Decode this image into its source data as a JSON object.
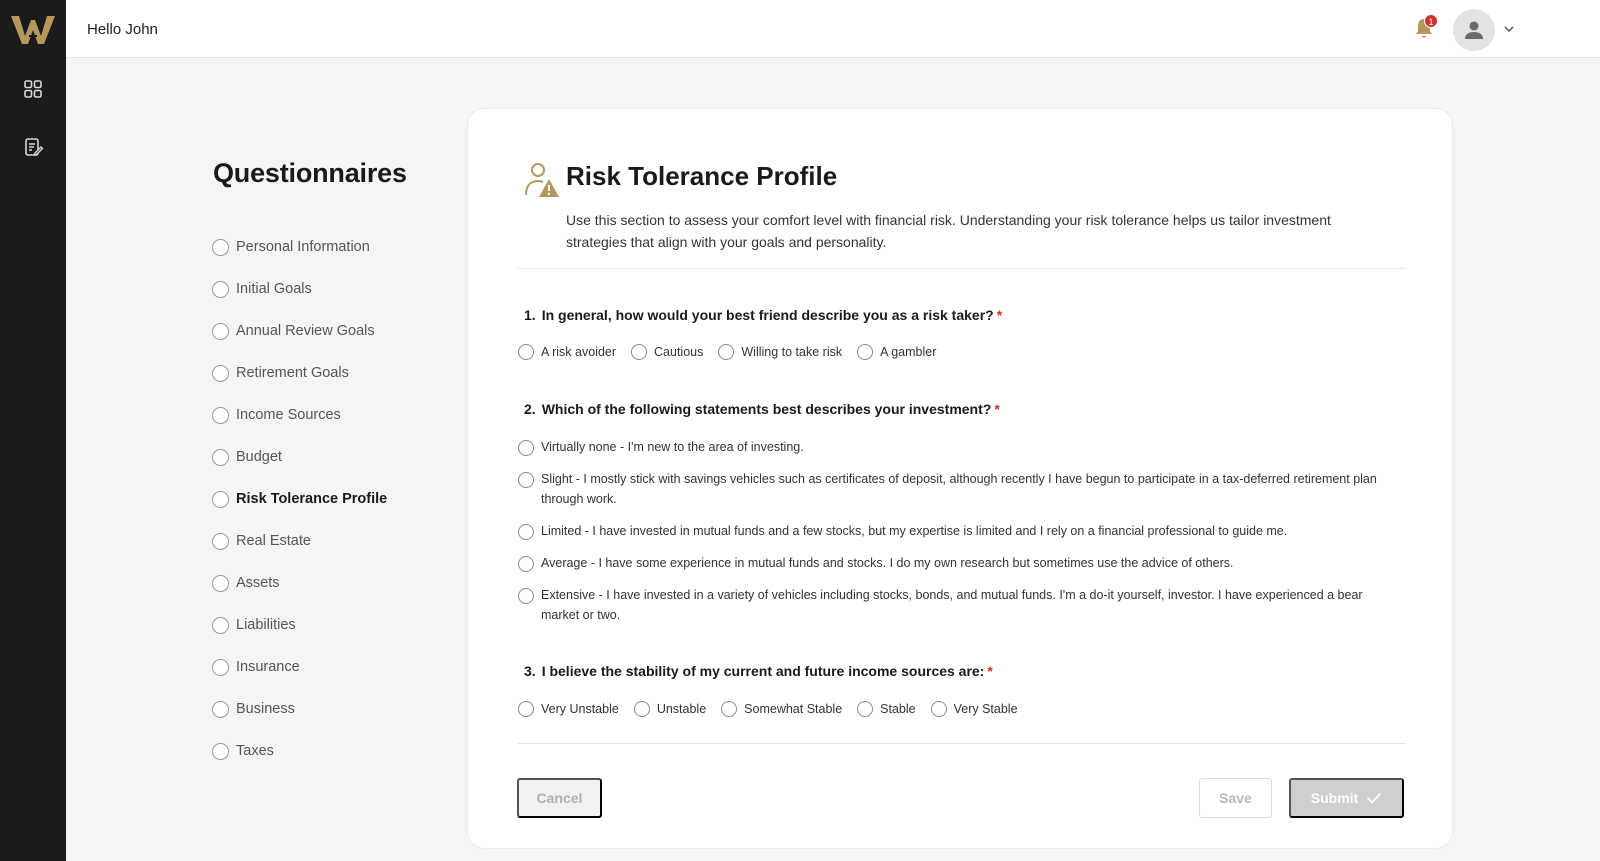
{
  "header": {
    "greeting": "Hello John",
    "notification_count": "1"
  },
  "questionnaires": {
    "title": "Questionnaires",
    "items": [
      {
        "label": "Personal Information",
        "active": false
      },
      {
        "label": "Initial Goals",
        "active": false
      },
      {
        "label": "Annual Review Goals",
        "active": false
      },
      {
        "label": "Retirement Goals",
        "active": false
      },
      {
        "label": "Income Sources",
        "active": false
      },
      {
        "label": "Budget",
        "active": false
      },
      {
        "label": "Risk Tolerance Profile",
        "active": true
      },
      {
        "label": "Real Estate",
        "active": false
      },
      {
        "label": "Assets",
        "active": false
      },
      {
        "label": "Liabilities",
        "active": false
      },
      {
        "label": "Insurance",
        "active": false
      },
      {
        "label": "Business",
        "active": false
      },
      {
        "label": "Taxes",
        "active": false
      }
    ]
  },
  "section": {
    "title": "Risk Tolerance Profile",
    "description": "Use this section to assess your comfort level with financial risk. Understanding your risk tolerance helps us tailor investment strategies that align with your goals and personality.",
    "questions": [
      {
        "number": "1.",
        "text": "In general, how would your best friend describe you as a risk taker?",
        "required": "*",
        "options": [
          "A risk avoider",
          "Cautious",
          "Willing to take risk",
          "A gambler"
        ]
      },
      {
        "number": "2.",
        "text": "Which of the following statements best describes your investment?",
        "required": "*",
        "options": [
          "Virtually none -  I'm new to the area of investing.",
          "Slight - I mostly stick with savings vehicles such as certificates of deposit, although recently I have begun to participate in a tax-deferred retirement plan through work.",
          "Limited - I have invested in mutual funds and a few stocks, but my expertise is limited and I rely on a financial professional to guide me.",
          "Average - I have some experience in mutual funds and stocks. I do my own research but sometimes use the advice of others.",
          "Extensive - I have invested in a variety of vehicles including stocks, bonds, and mutual funds. I'm a do-it yourself, investor. I have experienced a bear market or two."
        ]
      },
      {
        "number": "3.",
        "text": "I believe the stability of my current and future income sources are:",
        "required": "*",
        "options": [
          "Very Unstable",
          "Unstable",
          "Somewhat Stable",
          "Stable",
          "Very Stable"
        ]
      }
    ]
  },
  "actions": {
    "cancel_label": "Cancel",
    "save_label": "Save",
    "submit_label": "Submit"
  },
  "colors": {
    "brand_gold": "#b8975a",
    "rail_bg": "#1b1b1b",
    "required_red": "#d32f2f"
  }
}
